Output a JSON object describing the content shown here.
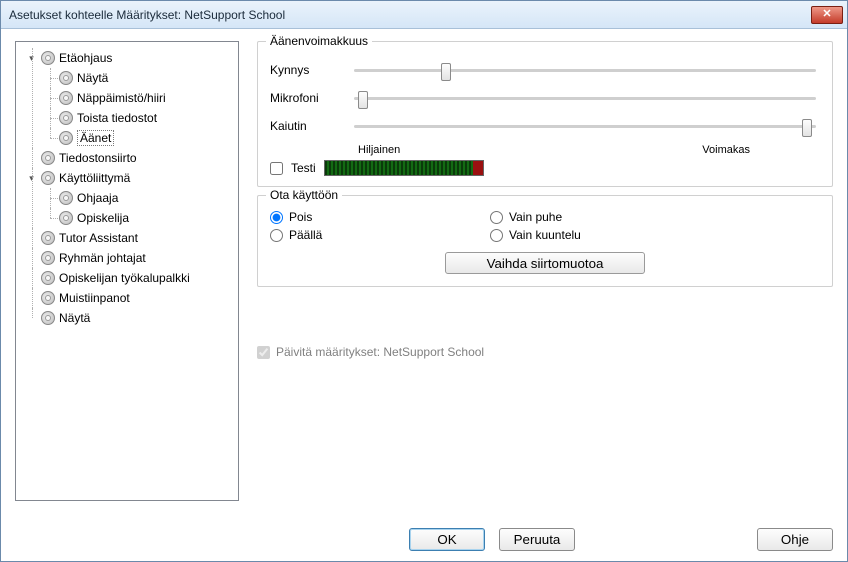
{
  "window": {
    "title": "Asetukset kohteelle Määritykset: NetSupport School"
  },
  "tree": {
    "nodes": [
      {
        "label": "Etäohjaus",
        "expanded": true,
        "children": [
          {
            "label": "Näytä"
          },
          {
            "label": "Näppäimistö/hiiri"
          },
          {
            "label": "Toista tiedostot"
          },
          {
            "label": "Äänet",
            "selected": true
          }
        ]
      },
      {
        "label": "Tiedostonsiirto"
      },
      {
        "label": "Käyttöliittymä",
        "expanded": true,
        "children": [
          {
            "label": "Ohjaaja"
          },
          {
            "label": "Opiskelija"
          }
        ]
      },
      {
        "label": "Tutor Assistant"
      },
      {
        "label": "Ryhmän johtajat"
      },
      {
        "label": "Opiskelijan työkalupalkki"
      },
      {
        "label": "Muistiinpanot"
      },
      {
        "label": "Näytä"
      }
    ]
  },
  "volume": {
    "group_title": "Äänenvoimakkuus",
    "rows": [
      {
        "label": "Kynnys",
        "pos": 20
      },
      {
        "label": "Mikrofoni",
        "pos": 2
      },
      {
        "label": "Kaiutin",
        "pos": 98
      }
    ],
    "low_label": "Hiljainen",
    "high_label": "Voimakas",
    "test_label": "Testi"
  },
  "enable": {
    "group_title": "Ota käyttöön",
    "options": {
      "off": "Pois",
      "speech_only": "Vain puhe",
      "on": "Päällä",
      "listen_only": "Vain kuuntelu"
    },
    "selected": "off",
    "change_format_btn": "Vaihda siirtomuotoa"
  },
  "update_check": {
    "label": "Päivitä määritykset: NetSupport School",
    "checked": true,
    "disabled": true
  },
  "footer": {
    "ok": "OK",
    "cancel": "Peruuta",
    "help": "Ohje"
  }
}
